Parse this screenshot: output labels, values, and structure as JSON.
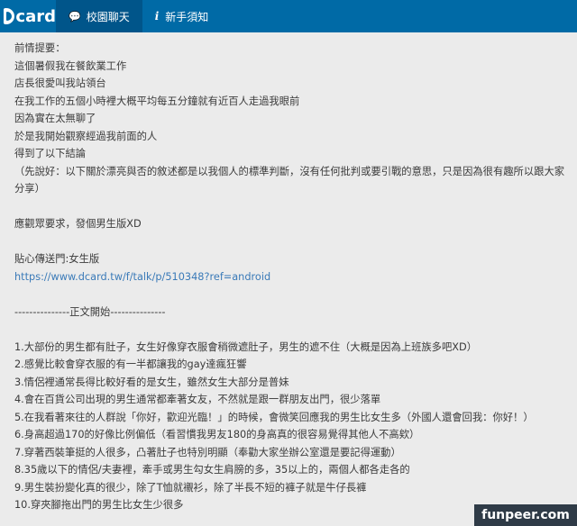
{
  "nav": {
    "logo_text": "card",
    "tabs": [
      {
        "label": "校園聊天",
        "icon": "chat-bubble-icon"
      },
      {
        "label": "新手須知",
        "icon": "info-icon"
      }
    ]
  },
  "post": {
    "lines": [
      "前情提要：",
      "這個暑假我在餐飲業工作",
      "店長很愛叫我站領台",
      "在我工作的五個小時裡大概平均每五分鐘就有近百人走過我眼前",
      "因為實在太無聊了",
      "於是我開始觀察經過我前面的人",
      "得到了以下結論"
    ],
    "disclaimer": "（先說好：以下關於漂亮與否的敘述都是以我個人的標準判斷，沒有任何批判或要引戰的意思，只是因為很有趣所以跟大家分享）",
    "request": "應觀眾要求，發個男生版XD",
    "portal_label": "貼心傳送門:女生版",
    "portal_link": "https://www.dcard.tw/f/talk/p/510348?ref=android",
    "divider": "---------------正文開始---------------",
    "items": [
      "1.大部份的男生都有肚子，女生好像穿衣服會稍微遮肚子，男生的遮不住（大概是因為上班族多吧XD）",
      "2.感覺比較會穿衣服的有一半都讓我的gay達瘋狂響",
      "3.情侶裡通常長得比較好看的是女生，雖然女生大部分是普妹",
      "4.會在百貨公司出現的男生通常都牽著女友，不然就是跟一群朋友出門，很少落單",
      "5.在我看著來往的人群說「你好，歡迎光臨！」的時候，會微笑回應我的男生比女生多（外國人還會回我：你好！）",
      "6.身高超過170的好像比例偏低（看習慣我男友180的身高真的很容易覺得其他人不高欸）",
      "7.穿著西裝筆挺的人很多，凸著肚子也特別明顯（奉勸大家坐辦公室還是要記得運動）",
      "8.35歲以下的情侶/夫妻裡，牽手或男生勾女生肩膀的多，35以上的，兩個人都各走各的",
      "9.男生裝扮變化真的很少，除了T恤就襯衫，除了半長不短的褲子就是牛仔長褲",
      "10.穿夾腳拖出門的男生比女生少很多"
    ]
  },
  "watermark": "funpeer.com",
  "colors": {
    "nav_bg": "#006aa6",
    "nav_active_bg": "#00558a",
    "page_bg": "#ebebeb",
    "link": "#3a7ab8"
  }
}
